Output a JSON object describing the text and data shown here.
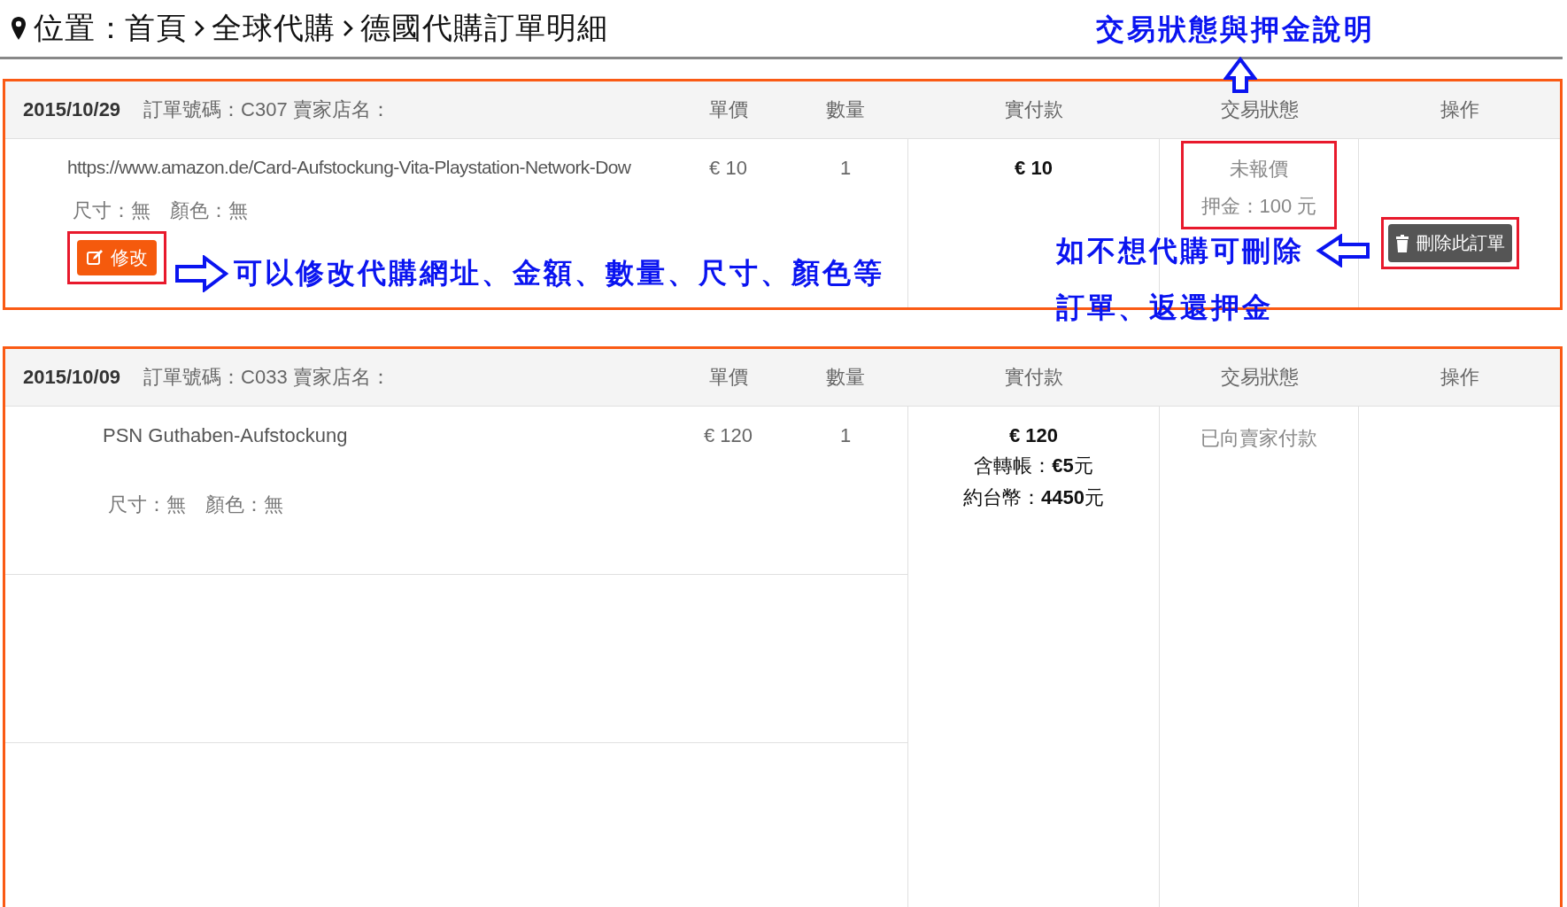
{
  "breadcrumb": {
    "label": "位置：",
    "items": [
      "首頁",
      "全球代購",
      "德國代購訂單明細"
    ]
  },
  "orders": [
    {
      "date": "2015/10/29",
      "info": "訂單號碼：C307 賣家店名：",
      "columns": [
        "單價",
        "數量",
        "實付款",
        "交易狀態",
        "操作"
      ],
      "items": [
        {
          "name": "https://www.amazon.de/Card-Aufstockung-Vita-Playstation-Network-Dow",
          "link": true,
          "size": "尺寸：無",
          "color_text": "顏色：無",
          "price": "€ 10",
          "qty": "1",
          "edit_button": {
            "label": "修改",
            "highlighted": true
          }
        }
      ],
      "paid_lines": [
        "€ 10"
      ],
      "status": {
        "lines": [
          "未報價",
          "押金：100 元"
        ],
        "highlighted": true
      },
      "actions": [
        {
          "kind": "delete",
          "label": "刪除此訂單",
          "highlighted": true
        }
      ]
    },
    {
      "date": "2015/10/09",
      "info": "訂單號碼：C033 賣家店名：",
      "columns": [
        "單價",
        "數量",
        "實付款",
        "交易狀態",
        "操作"
      ],
      "items": [
        {
          "name": "PSN Guthaben-Aufstockung",
          "link": false,
          "size": "尺寸：無",
          "color_text": "顏色：無",
          "price": "€ 120",
          "qty": "1"
        }
      ],
      "paid_lines": [
        "€ 120",
        "含轉帳：**€5**元",
        "約台幣：**4450**元"
      ],
      "status": {
        "lines": [
          "已向賣家付款"
        ],
        "highlighted": false
      }
    }
  ],
  "annotations": [
    {
      "kind": "right",
      "lines": [
        "可以修改代購網址、金額、數量、尺寸、顏色等"
      ]
    },
    {
      "kind": "up",
      "lines": [
        "交易狀態與押金說明"
      ]
    },
    {
      "kind": "left",
      "lines": [
        "如不想代購可刪除",
        "訂單、返還押金"
      ]
    }
  ]
}
